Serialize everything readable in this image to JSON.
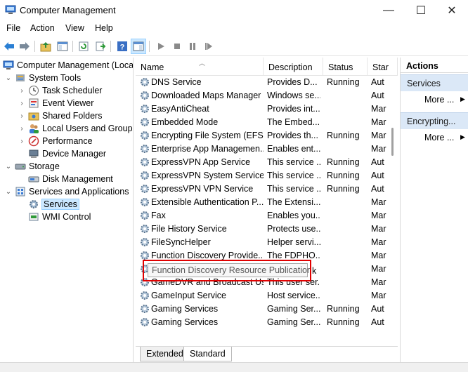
{
  "window": {
    "title": "Computer Management",
    "minimize_glyph": "—",
    "maximize_glyph": "☐",
    "close_glyph": "✕"
  },
  "menu": [
    "File",
    "Action",
    "View",
    "Help"
  ],
  "tree": {
    "root": "Computer Management (Local",
    "items": [
      {
        "label": "System Tools",
        "level": 1,
        "expander": "⌄"
      },
      {
        "label": "Task Scheduler",
        "level": 2,
        "expander": "›"
      },
      {
        "label": "Event Viewer",
        "level": 2,
        "expander": "›"
      },
      {
        "label": "Shared Folders",
        "level": 2,
        "expander": "›"
      },
      {
        "label": "Local Users and Groups",
        "level": 2,
        "expander": "›"
      },
      {
        "label": "Performance",
        "level": 2,
        "expander": "›"
      },
      {
        "label": "Device Manager",
        "level": 2,
        "expander": ""
      },
      {
        "label": "Storage",
        "level": 1,
        "expander": "⌄"
      },
      {
        "label": "Disk Management",
        "level": 2,
        "expander": ""
      },
      {
        "label": "Services and Applications",
        "level": 1,
        "expander": "⌄"
      },
      {
        "label": "Services",
        "level": 2,
        "expander": "",
        "selected": true
      },
      {
        "label": "WMI Control",
        "level": 2,
        "expander": ""
      }
    ]
  },
  "columns": {
    "name": "Name",
    "description": "Description",
    "status": "Status",
    "startup": "Star"
  },
  "services": [
    {
      "name": "DNS Service",
      "description": "Provides D...",
      "status": "Running",
      "startup": "Aut"
    },
    {
      "name": "Downloaded Maps Manager",
      "description": "Windows se...",
      "status": "",
      "startup": "Aut"
    },
    {
      "name": "EasyAntiCheat",
      "description": "Provides int...",
      "status": "",
      "startup": "Mar"
    },
    {
      "name": "Embedded Mode",
      "description": "The Embed...",
      "status": "",
      "startup": "Mar"
    },
    {
      "name": "Encrypting File System (EFS)",
      "description": "Provides th...",
      "status": "Running",
      "startup": "Mar"
    },
    {
      "name": "Enterprise App Managemen...",
      "description": "Enables ent...",
      "status": "",
      "startup": "Mar"
    },
    {
      "name": "ExpressVPN App Service",
      "description": "This service ...",
      "status": "Running",
      "startup": "Aut"
    },
    {
      "name": "ExpressVPN System Service",
      "description": "This service ...",
      "status": "Running",
      "startup": "Aut"
    },
    {
      "name": "ExpressVPN VPN Service",
      "description": "This service ...",
      "status": "Running",
      "startup": "Aut"
    },
    {
      "name": "Extensible Authentication P...",
      "description": "The Extensi...",
      "status": "",
      "startup": "Mar"
    },
    {
      "name": "Fax",
      "description": "Enables you...",
      "status": "",
      "startup": "Mar"
    },
    {
      "name": "File History Service",
      "description": "Protects use...",
      "status": "",
      "startup": "Mar"
    },
    {
      "name": "FileSyncHelper",
      "description": "Helper servi...",
      "status": "",
      "startup": "Mar"
    },
    {
      "name": "Function Discovery Provide...",
      "description": "The FDPHO...",
      "status": "",
      "startup": "Mar"
    },
    {
      "name": "",
      "description": "",
      "status": "",
      "startup": "Mar"
    },
    {
      "name": "GameDVR and Broadcast Us...",
      "description": "This user ser...",
      "status": "",
      "startup": "Mar"
    },
    {
      "name": "GameInput Service",
      "description": "Host service...",
      "status": "",
      "startup": "Mar"
    },
    {
      "name": "Gaming Services",
      "description": "Gaming Ser...",
      "status": "Running",
      "startup": "Aut"
    },
    {
      "name": "Gaming Services",
      "description": "Gaming Ser...",
      "status": "Running",
      "startup": "Aut"
    }
  ],
  "tooltip": {
    "text": "Function Discovery Resource Publication",
    "tail": "k"
  },
  "tabs": {
    "extended": "Extended",
    "standard": "Standard"
  },
  "actions": {
    "title": "Actions",
    "sections": [
      {
        "label": "Services",
        "more": "More ..."
      },
      {
        "label": "Encrypting...",
        "more": "More ..."
      }
    ],
    "arrow_glyph": "▶"
  },
  "colors": {
    "highlight_box": "#e00000",
    "selection": "#cce8ff",
    "actions_header": "#dbe8f7"
  }
}
